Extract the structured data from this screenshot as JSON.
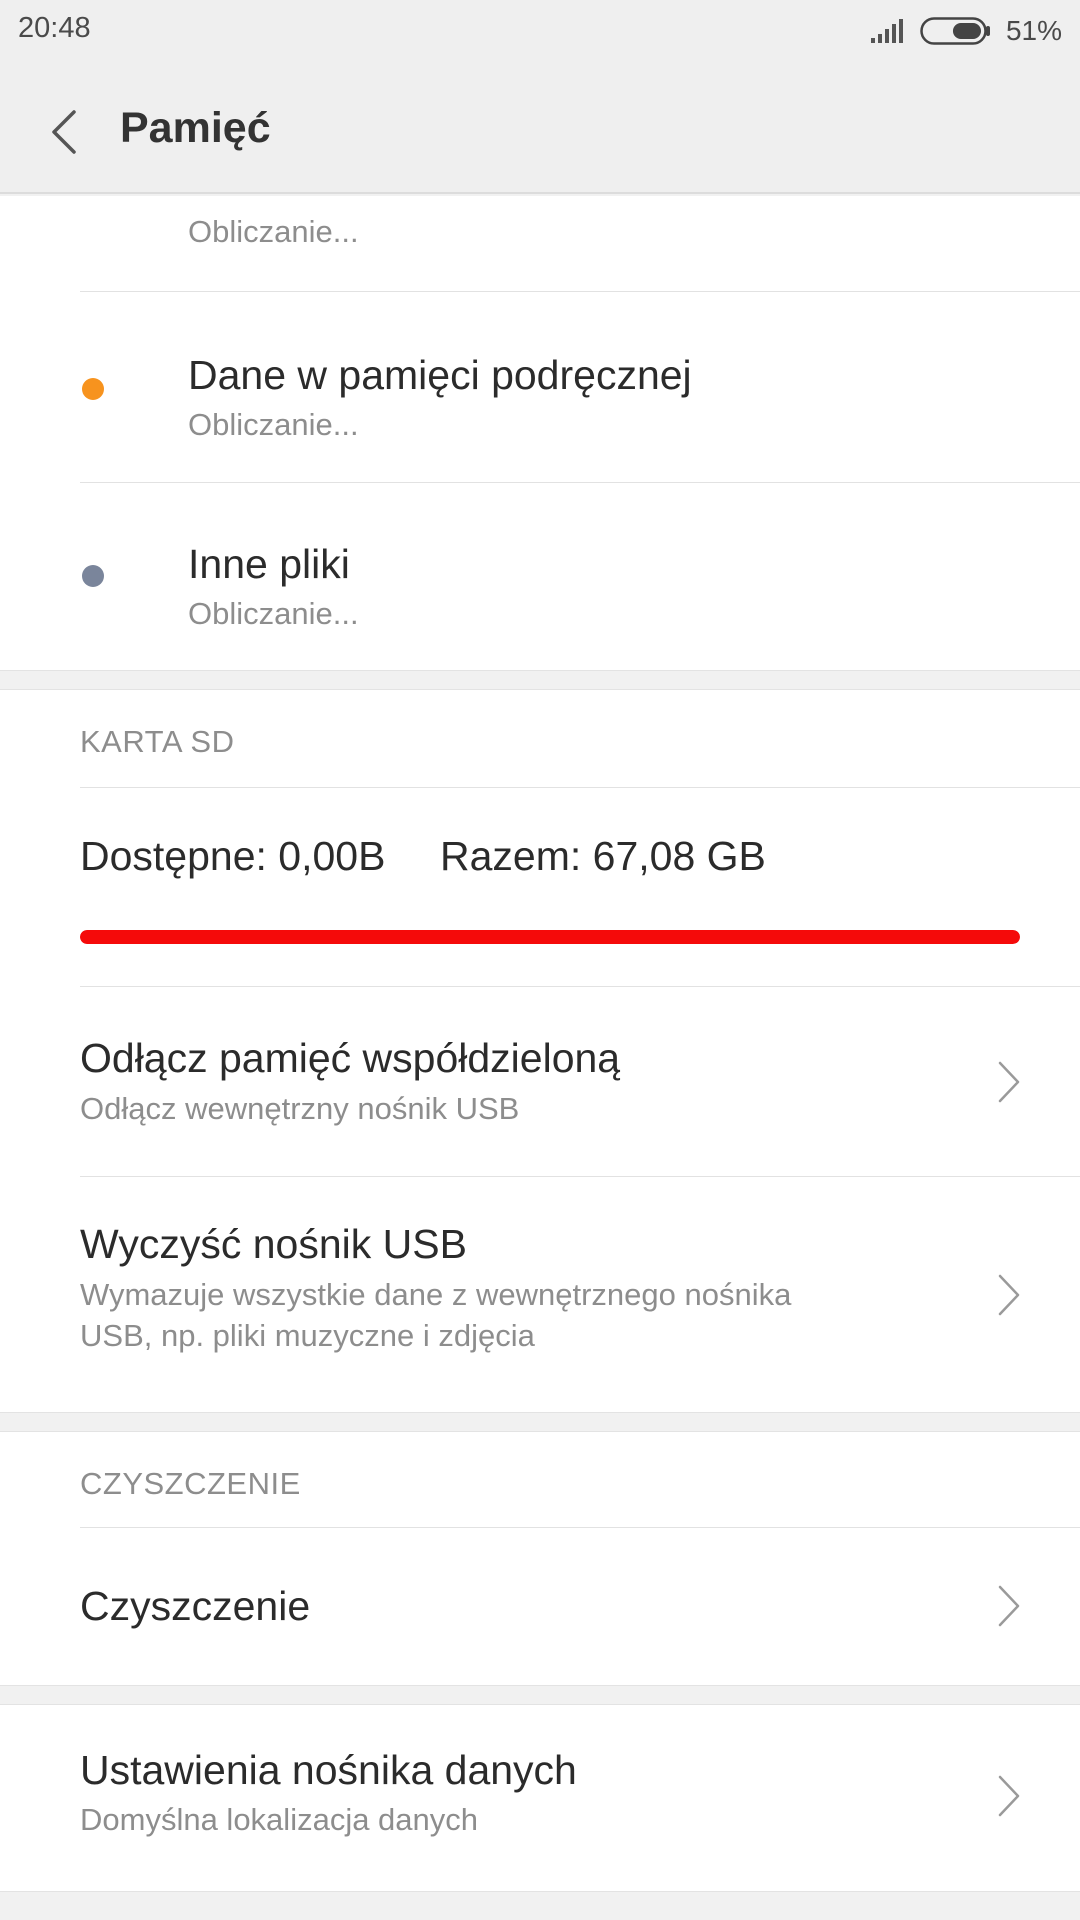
{
  "status_bar": {
    "time": "20:48",
    "battery_percent": "51%",
    "battery_level": 0.51,
    "icons": [
      "signal-icon",
      "battery-icon"
    ]
  },
  "header": {
    "title": "Pamięć",
    "back_icon": "chevron-left-icon"
  },
  "storage_categories": [
    {
      "title": "",
      "subtitle": "Obliczanie..."
    },
    {
      "title": "Dane w pamięci podręcznej",
      "subtitle": "Obliczanie...",
      "dot_color": "#f7931e"
    },
    {
      "title": "Inne pliki",
      "subtitle": "Obliczanie...",
      "dot_color": "#7a859b"
    }
  ],
  "sd_card": {
    "section_label": "KARTA SD",
    "available": "Dostępne: 0,00B",
    "total": "Razem: 67,08 GB",
    "used_fraction": 1.0,
    "bar_color": "#f50a0a",
    "items": [
      {
        "title": "Odłącz pamięć współdzieloną",
        "subtitle": "Odłącz wewnętrzny nośnik USB"
      },
      {
        "title": "Wyczyść nośnik USB",
        "subtitle_line1": "Wymazuje wszystkie dane z wewnętrznego nośnika",
        "subtitle_line2": "USB, np. pliki muzyczne i zdjęcia"
      }
    ]
  },
  "cleanup": {
    "section_label": "CZYSZCZENIE",
    "item_title": "Czyszczenie"
  },
  "storage_settings": {
    "title": "Ustawienia nośnika danych",
    "subtitle": "Domyślna lokalizacja danych"
  }
}
